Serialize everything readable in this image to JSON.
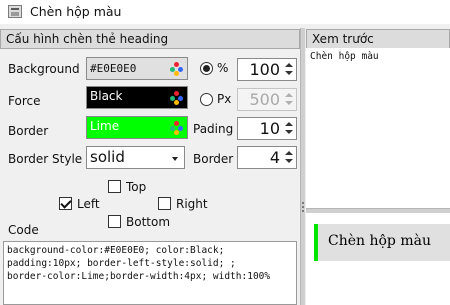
{
  "window": {
    "title": "Chèn hộp màu",
    "icon": "app-window-icon"
  },
  "left_panel": {
    "header": "Cấu hình chèn thẻ heading",
    "background": {
      "label": "Background",
      "value": "#E0E0E0",
      "color": "#e0e0e0",
      "icon": "palette-icon"
    },
    "force": {
      "label": "Force",
      "value": "Black",
      "color": "#000000",
      "icon": "palette-icon"
    },
    "border": {
      "label": "Border",
      "value": "Lime",
      "color": "#00ff00",
      "icon": "palette-icon"
    },
    "unit": {
      "percent_label": "%",
      "px_label": "Px",
      "selected": "%"
    },
    "percent_value": "100",
    "px_value": "500",
    "padding": {
      "label": "Pading",
      "value": "10"
    },
    "border_style": {
      "label": "Border Style",
      "value": "solid"
    },
    "border_width": {
      "label": "Border",
      "value": "4"
    },
    "sides": {
      "top": "Top",
      "left": "Left",
      "right": "Right",
      "bottom": "Bottom",
      "checked": [
        "left"
      ]
    },
    "code_label": "Code",
    "code": "background-color:#E0E0E0; color:Black;\npadding:10px; border-left-style:solid; ;\nborder-color:Lime;border-width:4px; width:100%"
  },
  "right_panel": {
    "header": "Xem trước",
    "source_text": "Chèn hộp màu",
    "rendered_text": "Chèn hộp màu",
    "preview_colors": {
      "background": "#e0e0e0",
      "text": "#000000",
      "border": "#00e600"
    }
  }
}
